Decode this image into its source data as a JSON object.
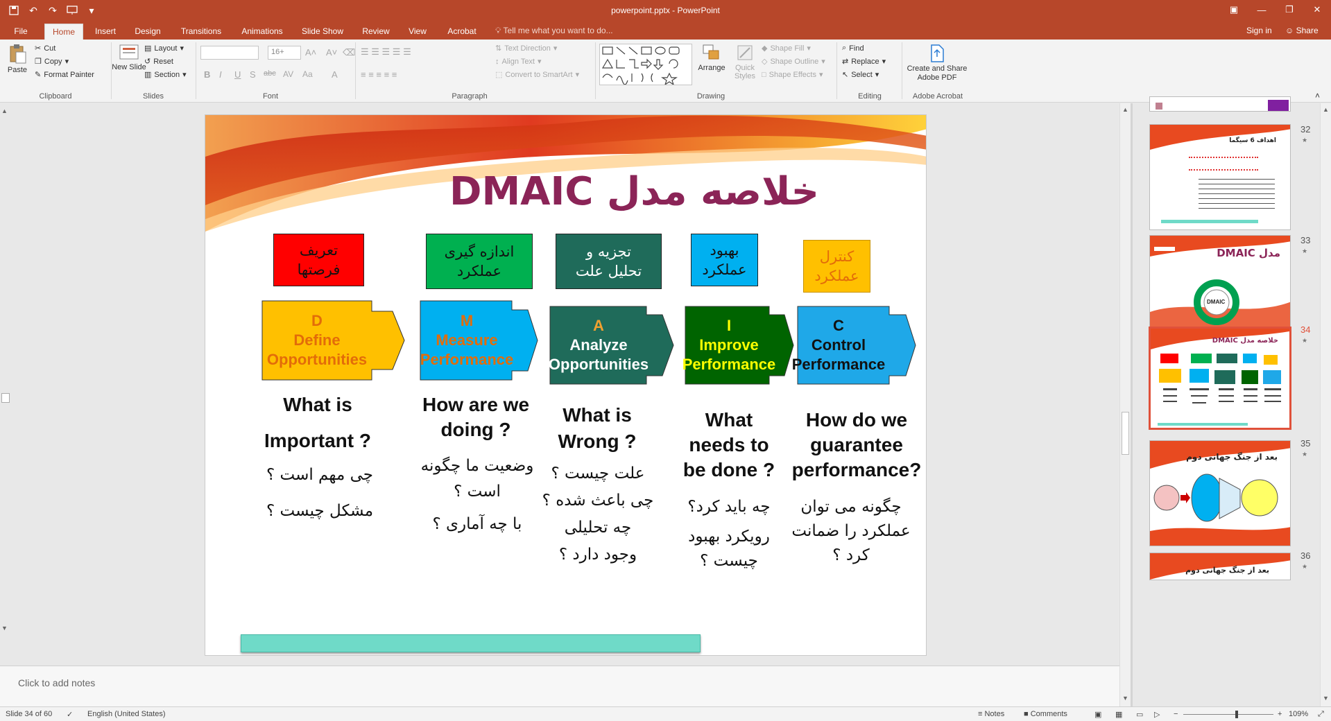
{
  "titlebar": {
    "title": "powerpoint.pptx - PowerPoint",
    "qat": [
      "save-icon",
      "undo-icon",
      "redo-icon",
      "start-presentation-icon",
      "customize-icon"
    ]
  },
  "tabs": [
    "File",
    "Home",
    "Insert",
    "Design",
    "Transitions",
    "Animations",
    "Slide Show",
    "Review",
    "View",
    "Acrobat"
  ],
  "tell_me": "Tell me what you want to do...",
  "sign_in": "Sign in",
  "share": "Share",
  "ribbon": {
    "clipboard": {
      "paste": "Paste",
      "cut": "Cut",
      "copy": "Copy",
      "format_painter": "Format Painter",
      "label": "Clipboard"
    },
    "slides": {
      "new_slide": "New Slide",
      "layout": "Layout",
      "reset": "Reset",
      "section": "Section",
      "label": "Slides"
    },
    "font": {
      "font_name": "",
      "font_size": "16+",
      "label": "Font"
    },
    "paragraph": {
      "text_direction": "Text Direction",
      "align_text": "Align Text",
      "convert_smartart": "Convert to SmartArt",
      "label": "Paragraph"
    },
    "drawing": {
      "arrange": "Arrange",
      "quick_styles": "Quick Styles",
      "shape_fill": "Shape Fill",
      "shape_outline": "Shape Outline",
      "shape_effects": "Shape Effects",
      "label": "Drawing"
    },
    "editing": {
      "find": "Find",
      "replace": "Replace",
      "select": "Select",
      "label": "Editing"
    },
    "acrobat": {
      "create_share": "Create and Share Adobe PDF",
      "label": "Adobe Acrobat"
    }
  },
  "slide": {
    "title": "خلاصه مدل DMAIC",
    "phases": [
      {
        "persian_line1": "تعریف",
        "persian_line2": "فرصتها",
        "letter": "D",
        "name_line1": "Define",
        "name_line2": "Opportunities",
        "question": "What is\nImportant ?",
        "persian_questions": [
          "چی مهم است ؟",
          "مشکل چیست ؟"
        ]
      },
      {
        "persian_line1": "اندازه گیری",
        "persian_line2": "عملکرد",
        "letter": "M",
        "name_line1": "Measure",
        "name_line2": "Performance",
        "question": "How are we doing ?",
        "persian_questions": [
          "وضعیت ما چگونه است ؟",
          "با چه آماری ؟"
        ]
      },
      {
        "persian_line1": "تجزیه و",
        "persian_line2": "تحلیل علت",
        "letter": "A",
        "name_line1": "Analyze",
        "name_line2": "Opportunities",
        "question": "What is Wrong ?",
        "persian_questions": [
          "علت چیست ؟",
          "چی باعث شده ؟",
          "چه تحلیلی",
          "وجود دارد ؟"
        ]
      },
      {
        "persian_line1": "بهبود",
        "persian_line2": "عملکرد",
        "letter": "I",
        "name_line1": "Improve",
        "name_line2": "Performance",
        "question": "What needs to be done ?",
        "persian_questions": [
          "چه باید کرد؟",
          "رویکرد بهبود چیست ؟"
        ]
      },
      {
        "persian_line1": "کنترل",
        "persian_line2": "عملکرد",
        "letter": "C",
        "name_line1": "Control",
        "name_line2": "Performance",
        "question": "How do we guarantee performance?",
        "persian_questions": [
          "چگونه می توان عملکرد را ضمانت کرد ؟"
        ]
      }
    ]
  },
  "notes_placeholder": "Click to add notes",
  "thumbnails": [
    {
      "number": "32",
      "title": "اهداف 6 سیگما"
    },
    {
      "number": "33",
      "title": "مدل DMAIC",
      "center": "DMAIC"
    },
    {
      "number": "34",
      "title": "خلاصه مدل DMAIC"
    },
    {
      "number": "35",
      "title": "بعد از جنگ جهانی دوم"
    },
    {
      "number": "36",
      "title": "بعد از جنگ جهانی دوم"
    }
  ],
  "status": {
    "slide_counter": "Slide 34 of 60",
    "language": "English (United States)",
    "notes": "Notes",
    "comments": "Comments",
    "zoom": "109%"
  },
  "colors": {
    "accent": "#b7472a",
    "title_color": "#8b2457",
    "define": "#ffc000",
    "measure": "#00b0f0",
    "analyze": "#1f6b5a",
    "improve": "#006400",
    "control": "#1fa8e8"
  }
}
